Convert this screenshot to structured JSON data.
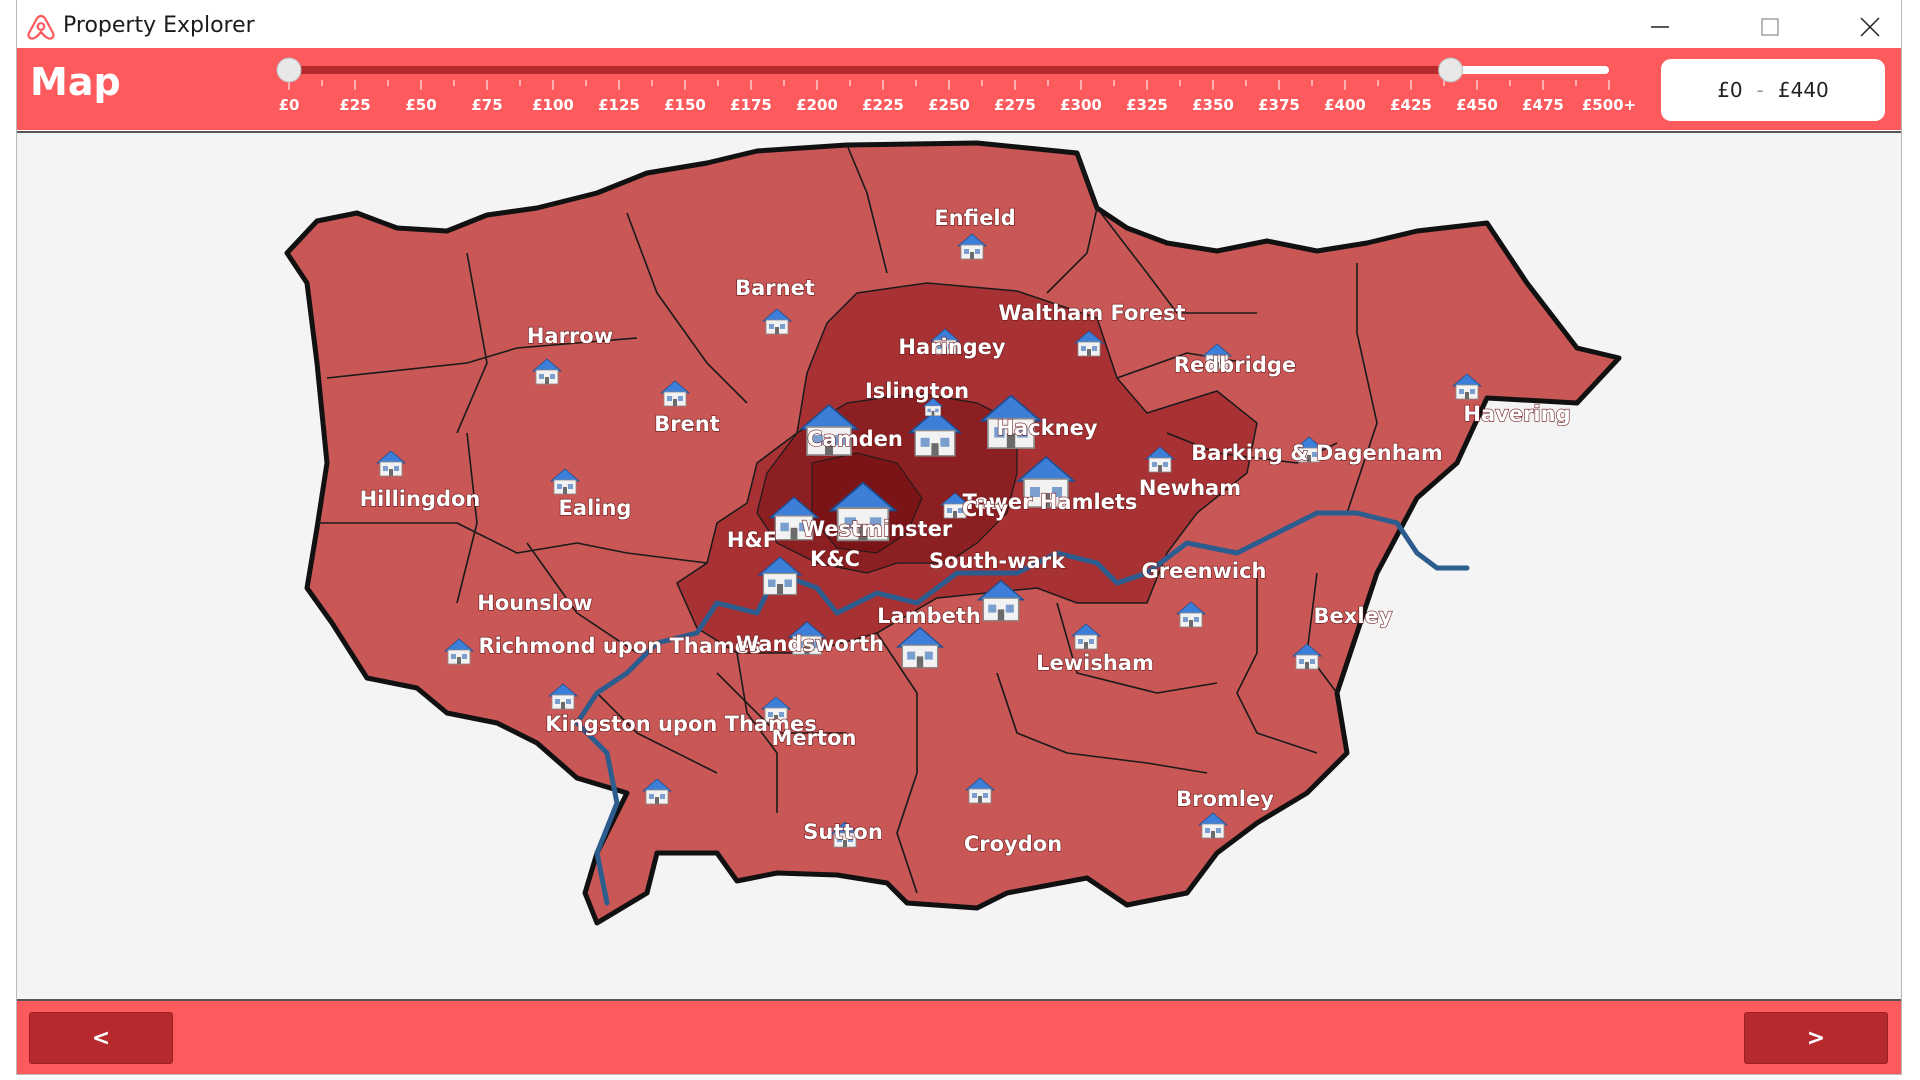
{
  "window": {
    "title": "Property Explorer",
    "app_icon": "airbnb-logo-icon",
    "controls": {
      "minimize": "minimize-icon",
      "maximize": "maximize-icon",
      "close": "close-icon"
    }
  },
  "header": {
    "title": "Map",
    "slider": {
      "ticks": [
        "£0",
        "£25",
        "£50",
        "£75",
        "£100",
        "£125",
        "£150",
        "£175",
        "£200",
        "£225",
        "£250",
        "£275",
        "£300",
        "£325",
        "£350",
        "£375",
        "£400",
        "£425",
        "£450",
        "£475",
        "£500+"
      ],
      "min_value": 0,
      "max_value": 440,
      "scale_max": 500
    },
    "price_range": {
      "min": "£0",
      "separator": "-",
      "max": "£440"
    }
  },
  "map": {
    "boroughs": [
      "Enfield",
      "Barnet",
      "Harrow",
      "Haringey",
      "Waltham Forest",
      "Redbridge",
      "Havering",
      "Islington",
      "Camden",
      "Hackney",
      "Brent",
      "Hillingdon",
      "Ealing",
      "Newham",
      "Barking & Dagenham",
      "Tower Hamlets",
      "Westminster",
      "City",
      "H&F",
      "K&C",
      "Hounslow",
      "South-wark",
      "Greenwich",
      "Bexley",
      "Richmond upon Thames",
      "Wandsworth",
      "Lambeth",
      "Lewisham",
      "Kingston upon Thames",
      "Merton",
      "Sutton",
      "Croydon",
      "Bromley"
    ],
    "colors": {
      "light": "#c85756",
      "medium": "#a83133",
      "dark": "#8c1f22",
      "darkest": "#7a1416",
      "river": "#2d5d8e",
      "border": "#1a1a1a"
    }
  },
  "footer": {
    "prev_label": "<",
    "next_label": ">"
  },
  "colors": {
    "accent": "#fc5a5d",
    "button": "#b62a2e"
  }
}
